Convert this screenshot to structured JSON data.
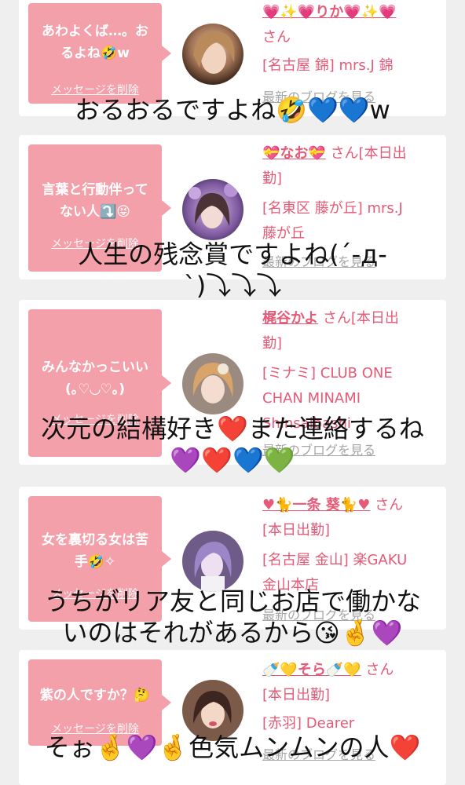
{
  "delete_label": "メッセージを削除",
  "blog_label": "最新のブログを見る",
  "cards": [
    {
      "message": "あわよくば…。お\nるよね🤣w",
      "name": "💗✨💗りか💗✨💗",
      "suffix": "",
      "line2": "さん",
      "line3": "[名古屋 錦] mrs.J 錦",
      "line4": ""
    },
    {
      "message": "言葉と行動伴って\nない人⤵️😝",
      "name": "💝なお💝",
      "suffix": "さん[本日出",
      "line2": "勤]",
      "line3": "[名東区 藤が丘] mrs.J",
      "line4": "藤が丘"
    },
    {
      "message": "みんなかっこいい\n(｡♡◡♡｡)",
      "name": "梶谷かよ",
      "suffix": "さん[本日出",
      "line2": "勤]",
      "line3": "[ミナミ] CLUB ONE",
      "line4": "CHAN MINAMI"
    },
    {
      "message": "女を裏切る女は苦\n手🤣✧",
      "name": "♥🐈一条 葵🐈♥",
      "suffix": "さん",
      "line2": "[本日出勤]",
      "line3": "[名古屋 金山] 楽GAKU",
      "line4": "金山本店"
    },
    {
      "message": "紫の人ですか？🤔",
      "name": "🍼💛そら🍼💛",
      "suffix": "さん",
      "line2": "[本日出勤]",
      "line3": "[赤羽] Dearer",
      "line4": ""
    }
  ],
  "extra_lines": {
    "card3_line5": "Shinsaibashi"
  },
  "captions": {
    "c1": "おるおるですよね🤣💙💙w",
    "c2a": "人生の残念賞ですよね(´-д-",
    "c2b": "`)⤵⤵⤵",
    "c3a": "次元の結構好き❤️また連絡するね",
    "c3b": "💜❤️💙💚",
    "c4a": "うちがリア友と同じお店で働かな",
    "c4b": "いのはそれがあるから😘🤞💜",
    "c5": "そぉ🤞💜🤞色気ムンムンの人❤️"
  },
  "colors": {
    "background": "#efefef",
    "bubble": "#f4a0aa",
    "accent": "#e65a77",
    "muted": "#a6a6a6"
  }
}
